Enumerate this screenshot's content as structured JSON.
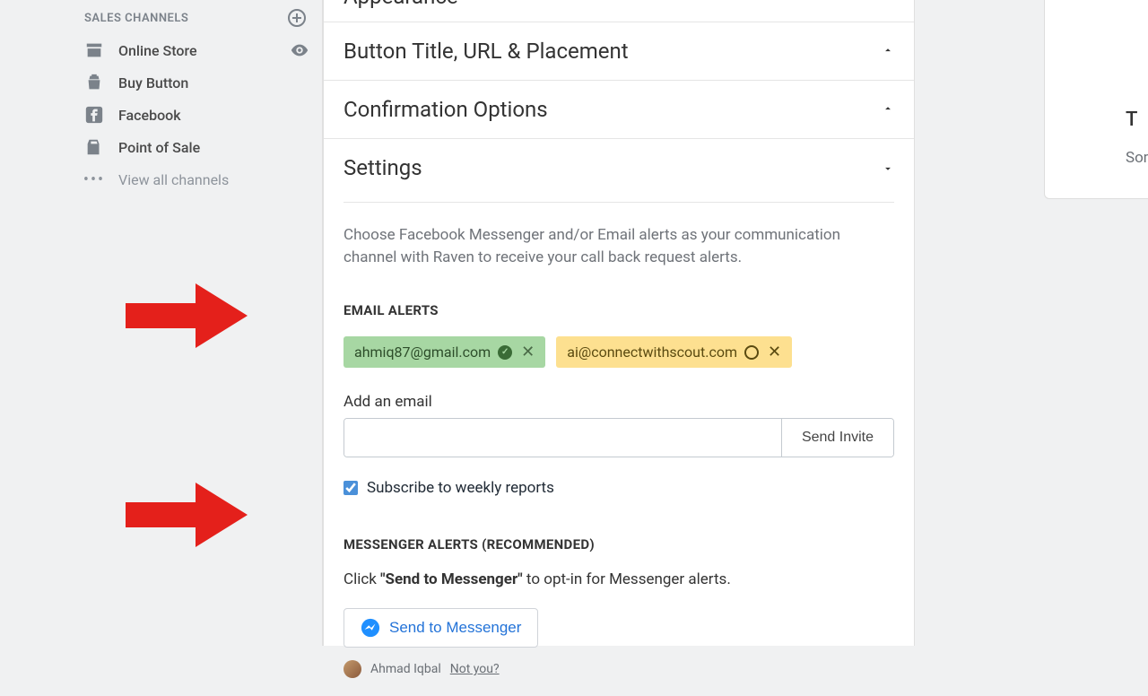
{
  "sidebar": {
    "header": "SALES CHANNELS",
    "items": [
      {
        "label": "Online Store",
        "icon": "store"
      },
      {
        "label": "Buy Button",
        "icon": "buybutton"
      },
      {
        "label": "Facebook",
        "icon": "facebook"
      },
      {
        "label": "Point of Sale",
        "icon": "pos"
      }
    ],
    "view_all": "View all channels"
  },
  "sections": {
    "appearance": "Appearance",
    "button_title": "Button Title, URL & Placement",
    "confirmation": "Confirmation Options",
    "settings": "Settings"
  },
  "settings_body": {
    "description": "Choose Facebook Messenger and/or Email alerts as your communication channel with Raven to receive your call back request alerts.",
    "email_heading": "EMAIL ALERTS",
    "emails": [
      {
        "address": "ahmiq87@gmail.com",
        "status": "verified"
      },
      {
        "address": "ai@connectwithscout.com",
        "status": "pending"
      }
    ],
    "add_email_label": "Add an email",
    "send_invite": "Send Invite",
    "subscribe_label": "Subscribe to weekly reports",
    "subscribe_checked": true,
    "messenger_heading": "MESSENGER ALERTS (RECOMMENDED)",
    "messenger_line_prefix": "Click ",
    "messenger_line_bold": "\"Send to Messenger\"",
    "messenger_line_suffix": " to opt-in for Messenger alerts.",
    "send_to_messenger": "Send to Messenger",
    "user_name": "Ahmad Iqbal",
    "not_you": "Not you?"
  },
  "right_card": {
    "title": "T",
    "sub": "Som"
  },
  "colors": {
    "arrow": "#e4201b",
    "verified_bg": "#a7d7a3",
    "pending_bg": "#fde090",
    "link_blue": "#2373d8"
  }
}
